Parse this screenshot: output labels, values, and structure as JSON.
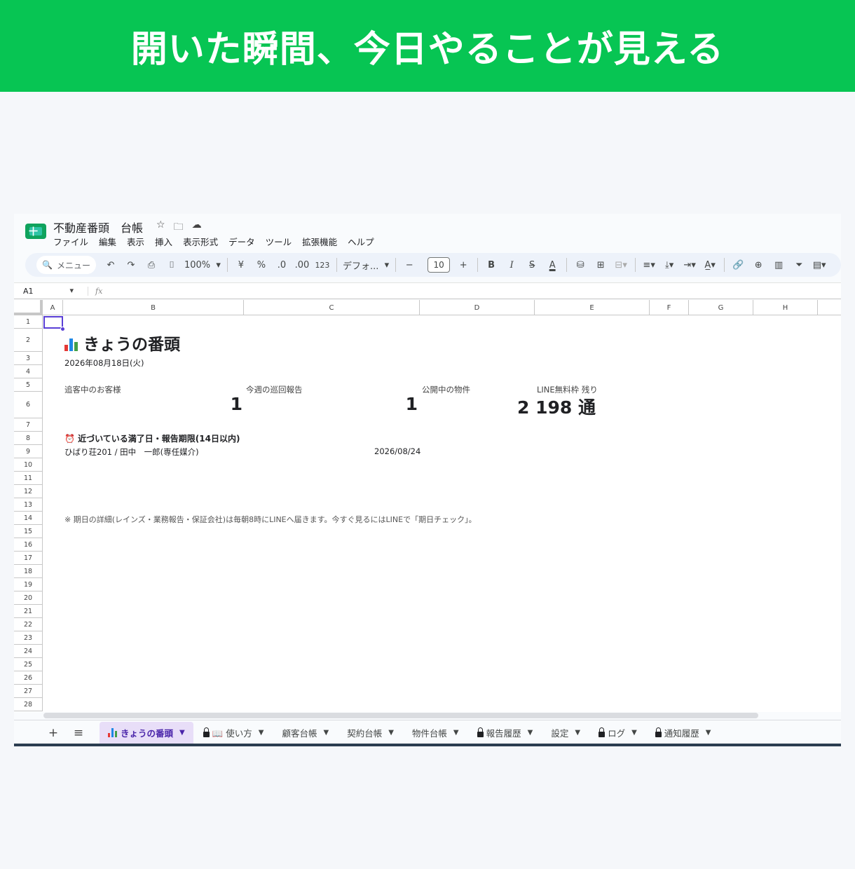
{
  "banner": {
    "headline": "開いた瞬間、今日やることが見える"
  },
  "app": {
    "doc_title": "不動産番頭　台帳",
    "menu": [
      "ファイル",
      "編集",
      "表示",
      "挿入",
      "表示形式",
      "データ",
      "ツール",
      "拡張機能",
      "ヘルプ"
    ],
    "toolbar": {
      "search_label": "メニュー",
      "zoom": "100%",
      "currency": "¥",
      "percent": "%",
      "dec_decrease": ".0",
      "dec_increase": ".00",
      "number_format": "123",
      "font": "デフォ...",
      "font_size": "10",
      "bold": "B",
      "italic": "I",
      "strike": "S",
      "text_color": "A"
    },
    "formula_bar": {
      "cell_ref": "A1",
      "fx": "fx"
    },
    "columns": [
      "A",
      "B",
      "C",
      "D",
      "E",
      "F",
      "G",
      "H"
    ],
    "rows": [
      "1",
      "2",
      "3",
      "4",
      "5",
      "6",
      "7",
      "8",
      "9",
      "10",
      "11",
      "12",
      "13",
      "14",
      "15",
      "16",
      "17",
      "18",
      "19",
      "20",
      "21",
      "22",
      "23",
      "24",
      "25",
      "26",
      "27",
      "28"
    ],
    "sheet": {
      "title": "きょうの番頭",
      "date": "2026年08月18日(火)",
      "metrics": [
        {
          "label": "追客中のお客様",
          "value": "1"
        },
        {
          "label": "今週の巡回報告",
          "value": "1"
        },
        {
          "label": "公開中の物件",
          "value": "2 198 通"
        },
        {
          "label": "LINE無料枠 残り",
          "value": ""
        }
      ],
      "section_title": "⏰ 近づいている満了日・報告期限(14日以内)",
      "deadline_row": {
        "name": "ひばり荘201 / 田中　一郎(専任媒介)",
        "date": "2026/08/24"
      },
      "note": "※ 期日の詳細(レインズ・業務報告・保証会社)は毎朝8時にLINEへ届きます。今すぐ見るにはLINEで「期日チェック」。"
    },
    "tabs": [
      {
        "label": "きょうの番頭",
        "active": true,
        "lock": false,
        "icon": "bar-chart-icon"
      },
      {
        "label": "📖 使い方",
        "active": false,
        "lock": true
      },
      {
        "label": "顧客台帳",
        "active": false,
        "lock": false
      },
      {
        "label": "契約台帳",
        "active": false,
        "lock": false
      },
      {
        "label": "物件台帳",
        "active": false,
        "lock": false
      },
      {
        "label": "報告履歴",
        "active": false,
        "lock": true
      },
      {
        "label": "設定",
        "active": false,
        "lock": false
      },
      {
        "label": "ログ",
        "active": false,
        "lock": true
      },
      {
        "label": "通知履歴",
        "active": false,
        "lock": true
      }
    ],
    "colors": {
      "banner_green": "#07c553",
      "selection": "#5a3fd6",
      "active_tab_bg": "#e8def8"
    }
  }
}
